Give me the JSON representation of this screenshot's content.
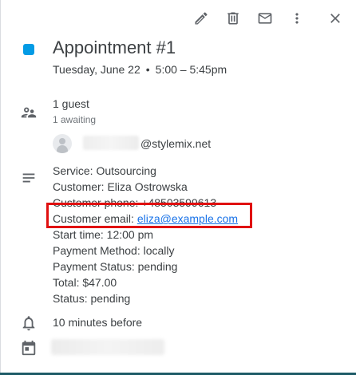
{
  "event": {
    "title": "Appointment #1",
    "date": "Tuesday, June 22",
    "dot": "•",
    "time": "5:00 – 5:45pm",
    "color": "#039be5"
  },
  "toolbar": {
    "edit_icon": "pencil-icon",
    "delete_icon": "trash-icon",
    "email_icon": "mail-icon",
    "more_icon": "more-vert-icon",
    "close_icon": "close-icon"
  },
  "guests": {
    "count": "1 guest",
    "awaiting": "1 awaiting",
    "email_domain": "@stylemix.net"
  },
  "description": {
    "service": "Service: Outsourcing",
    "customer": "Customer: Eliza Ostrowska",
    "phone": "Customer phone: +48503599613",
    "email_label": "Customer email: ",
    "email_link": "eliza@example.com",
    "start_time": "Start time: 12:00 pm",
    "payment_method": "Payment Method: locally",
    "payment_status": "Payment Status: pending",
    "total": "Total: $47.00",
    "status": "Status: pending"
  },
  "reminder": {
    "text": "10 minutes before"
  },
  "colors": {
    "accent": "#039be5",
    "link": "#1a73e8",
    "highlight_box": "#e01010",
    "bottom_bar": "#1e5b67"
  }
}
